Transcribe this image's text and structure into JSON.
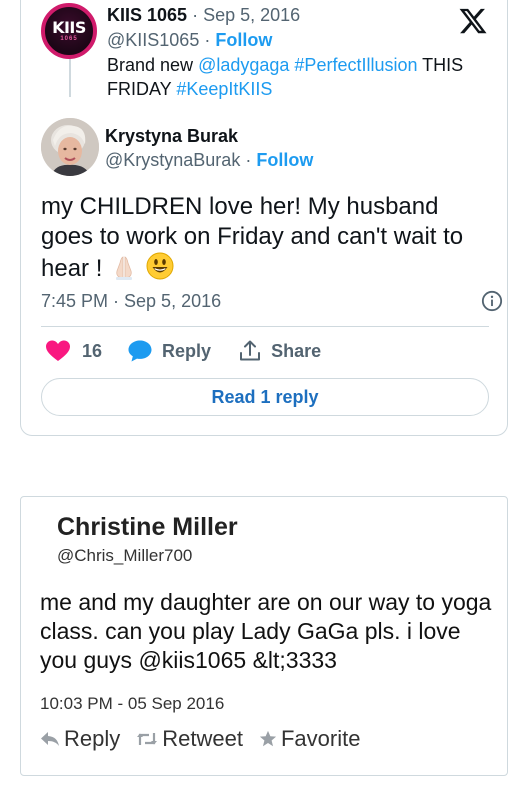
{
  "tweet": {
    "parent": {
      "logo_text": "KIIS",
      "logo_sub": "1065",
      "name": "KIIS 1065",
      "separator": "·",
      "date": "Sep 5, 2016",
      "handle": "@KIIS1065",
      "follow": "Follow",
      "text_prefix": "Brand new ",
      "mention": "@ladygaga",
      "hashtag1": "#PerfectIllusion",
      "text_mid": " THIS FRIDAY ",
      "hashtag2": "#KeepItKIIS"
    },
    "reply": {
      "name": "Krystyna Burak",
      "handle": "@KrystynaBurak",
      "separator": "·",
      "follow": "Follow",
      "text": "my CHILDREN love her! My husband goes to work on Friday and can't wait to hear !",
      "timestamp": "7:45 PM · Sep 5, 2016",
      "like_count": "16",
      "reply_label": "Reply",
      "share_label": "Share",
      "read_replies": "Read 1 reply"
    },
    "colors": {
      "accent": "#1d9bf0",
      "like": "#f91880",
      "muted": "#536471",
      "border": "#cfd9de"
    }
  },
  "embed": {
    "name": "Christine Miller",
    "handle": "@Chris_Miller700",
    "text": "me and my daughter are on our way to yoga class. can you play Lady GaGa pls. i love you guys @kiis1065 &lt;3333",
    "timestamp": "10:03 PM - 05 Sep 2016",
    "actions": {
      "reply": "Reply",
      "retweet": "Retweet",
      "favorite": "Favorite"
    }
  }
}
